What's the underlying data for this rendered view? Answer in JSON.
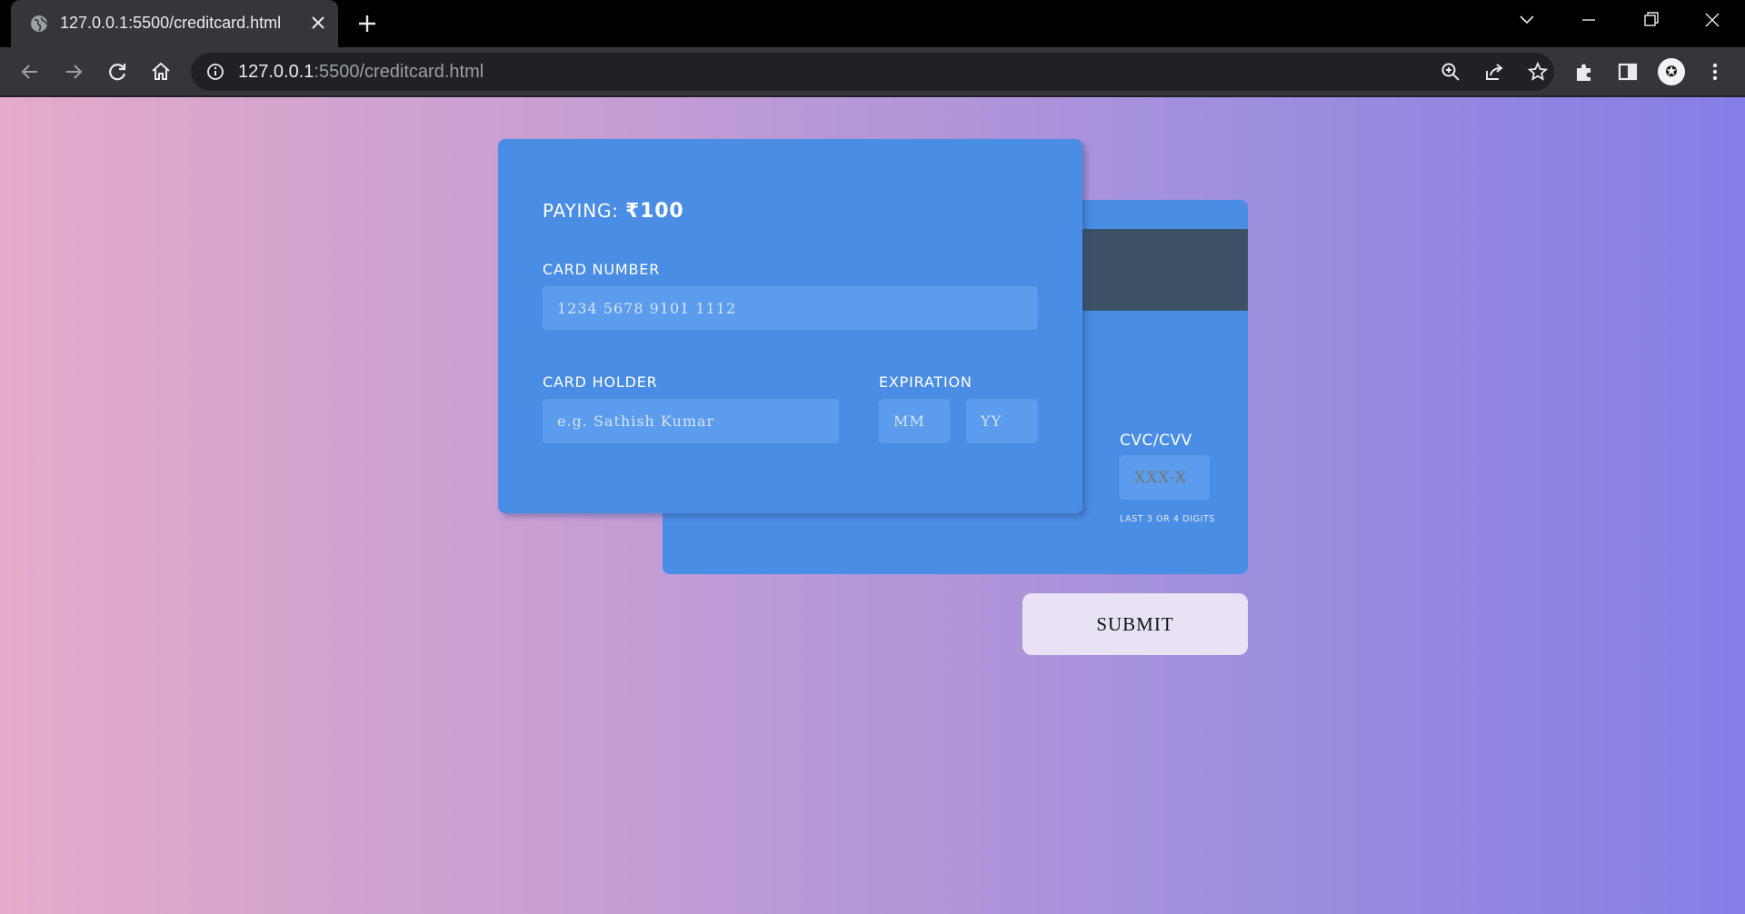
{
  "browser": {
    "tab_title": "127.0.0.1:5500/creditcard.html",
    "url_host": "127.0.0.1",
    "url_rest": ":5500/creditcard.html"
  },
  "form": {
    "paying_label": "PAYING:",
    "paying_amount": "₹100",
    "card_number_label": "CARD NUMBER",
    "card_number_placeholder": "1234 5678 9101 1112",
    "card_holder_label": "CARD HOLDER",
    "card_holder_placeholder": "e.g. Sathish Kumar",
    "expiration_label": "EXPIRATION",
    "month_placeholder": "MM",
    "year_placeholder": "YY",
    "cvc_label": "CVC/CVV",
    "cvc_placeholder": "XXX-X",
    "cvc_hint": "LAST 3 OR 4 DIGITS",
    "submit_label": "SUBMIT"
  },
  "colors": {
    "card": "#4a8de4",
    "input": "#5b9cec",
    "stripe": "#3c5166",
    "submit_bg": "#e8e2f4",
    "gradient_start": "#e4abca",
    "gradient_end": "#857ee6"
  },
  "icons": {
    "favicon": "globe-icon",
    "tab_close": "close-icon",
    "new_tab": "plus-icon",
    "back": "arrow-left-icon",
    "forward": "arrow-right-icon",
    "reload": "reload-icon",
    "home": "home-icon",
    "site_info": "info-icon",
    "zoom": "zoom-icon",
    "share": "share-icon",
    "bookmark": "star-icon",
    "extensions": "puzzle-icon",
    "side_panel": "side-panel-icon",
    "menu": "kebab-menu-icon"
  }
}
